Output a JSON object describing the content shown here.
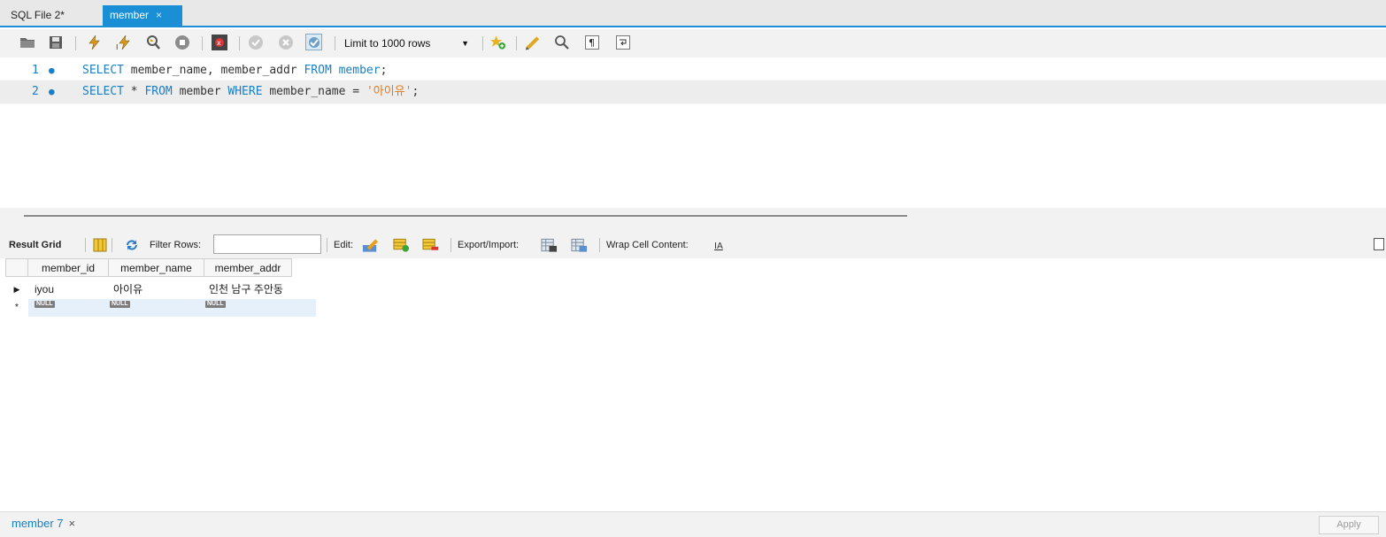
{
  "tabs": [
    {
      "label": "SQL File 2*"
    },
    {
      "label": "member",
      "close": "×"
    }
  ],
  "toolbar": {
    "limit_select": "Limit to 1000 rows",
    "icons": [
      "folder-open-icon",
      "save-icon",
      "execute-icon",
      "execute-current-icon",
      "explain-icon",
      "stop-icon",
      "toggle-error-icon",
      "commit-icon",
      "rollback-icon",
      "autocommit-icon",
      "limit-select",
      "add-snippet-icon",
      "beautify-icon",
      "find-icon",
      "invisible-chars-icon",
      "wrap-icon"
    ]
  },
  "editor": {
    "lines": [
      {
        "num": "1",
        "parts": [
          [
            "kw",
            "SELECT"
          ],
          [
            "t",
            " member_name, member_addr "
          ],
          [
            "kw",
            "FROM"
          ],
          [
            "t",
            " "
          ],
          [
            "kw",
            "member"
          ],
          [
            "t",
            ";"
          ]
        ]
      },
      {
        "num": "2",
        "parts": [
          [
            "kw",
            "SELECT"
          ],
          [
            "t",
            " * "
          ],
          [
            "kw",
            "FROM"
          ],
          [
            "t",
            " member "
          ],
          [
            "kw",
            "WHERE"
          ],
          [
            "t",
            " member_name = "
          ],
          [
            "str",
            "'아이유'"
          ],
          [
            "t",
            ";"
          ]
        ]
      }
    ]
  },
  "result_toolbar": {
    "result_grid": "Result Grid",
    "filter_rows": "Filter Rows:",
    "edit": "Edit:",
    "export_import": "Export/Import:",
    "wrap_cell": "Wrap Cell Content:"
  },
  "grid": {
    "columns": [
      "member_id",
      "member_name",
      "member_addr"
    ],
    "rows": [
      [
        "iyou",
        "아이유",
        "인천 남구 주안동"
      ]
    ],
    "null_label": "NULL"
  },
  "bottom": {
    "tab_label": "member 7",
    "close": "×",
    "apply": "Apply"
  },
  "colors": {
    "accent": "#1b8fd6",
    "keyword": "#1a7fc4",
    "string": "#e2791b"
  }
}
